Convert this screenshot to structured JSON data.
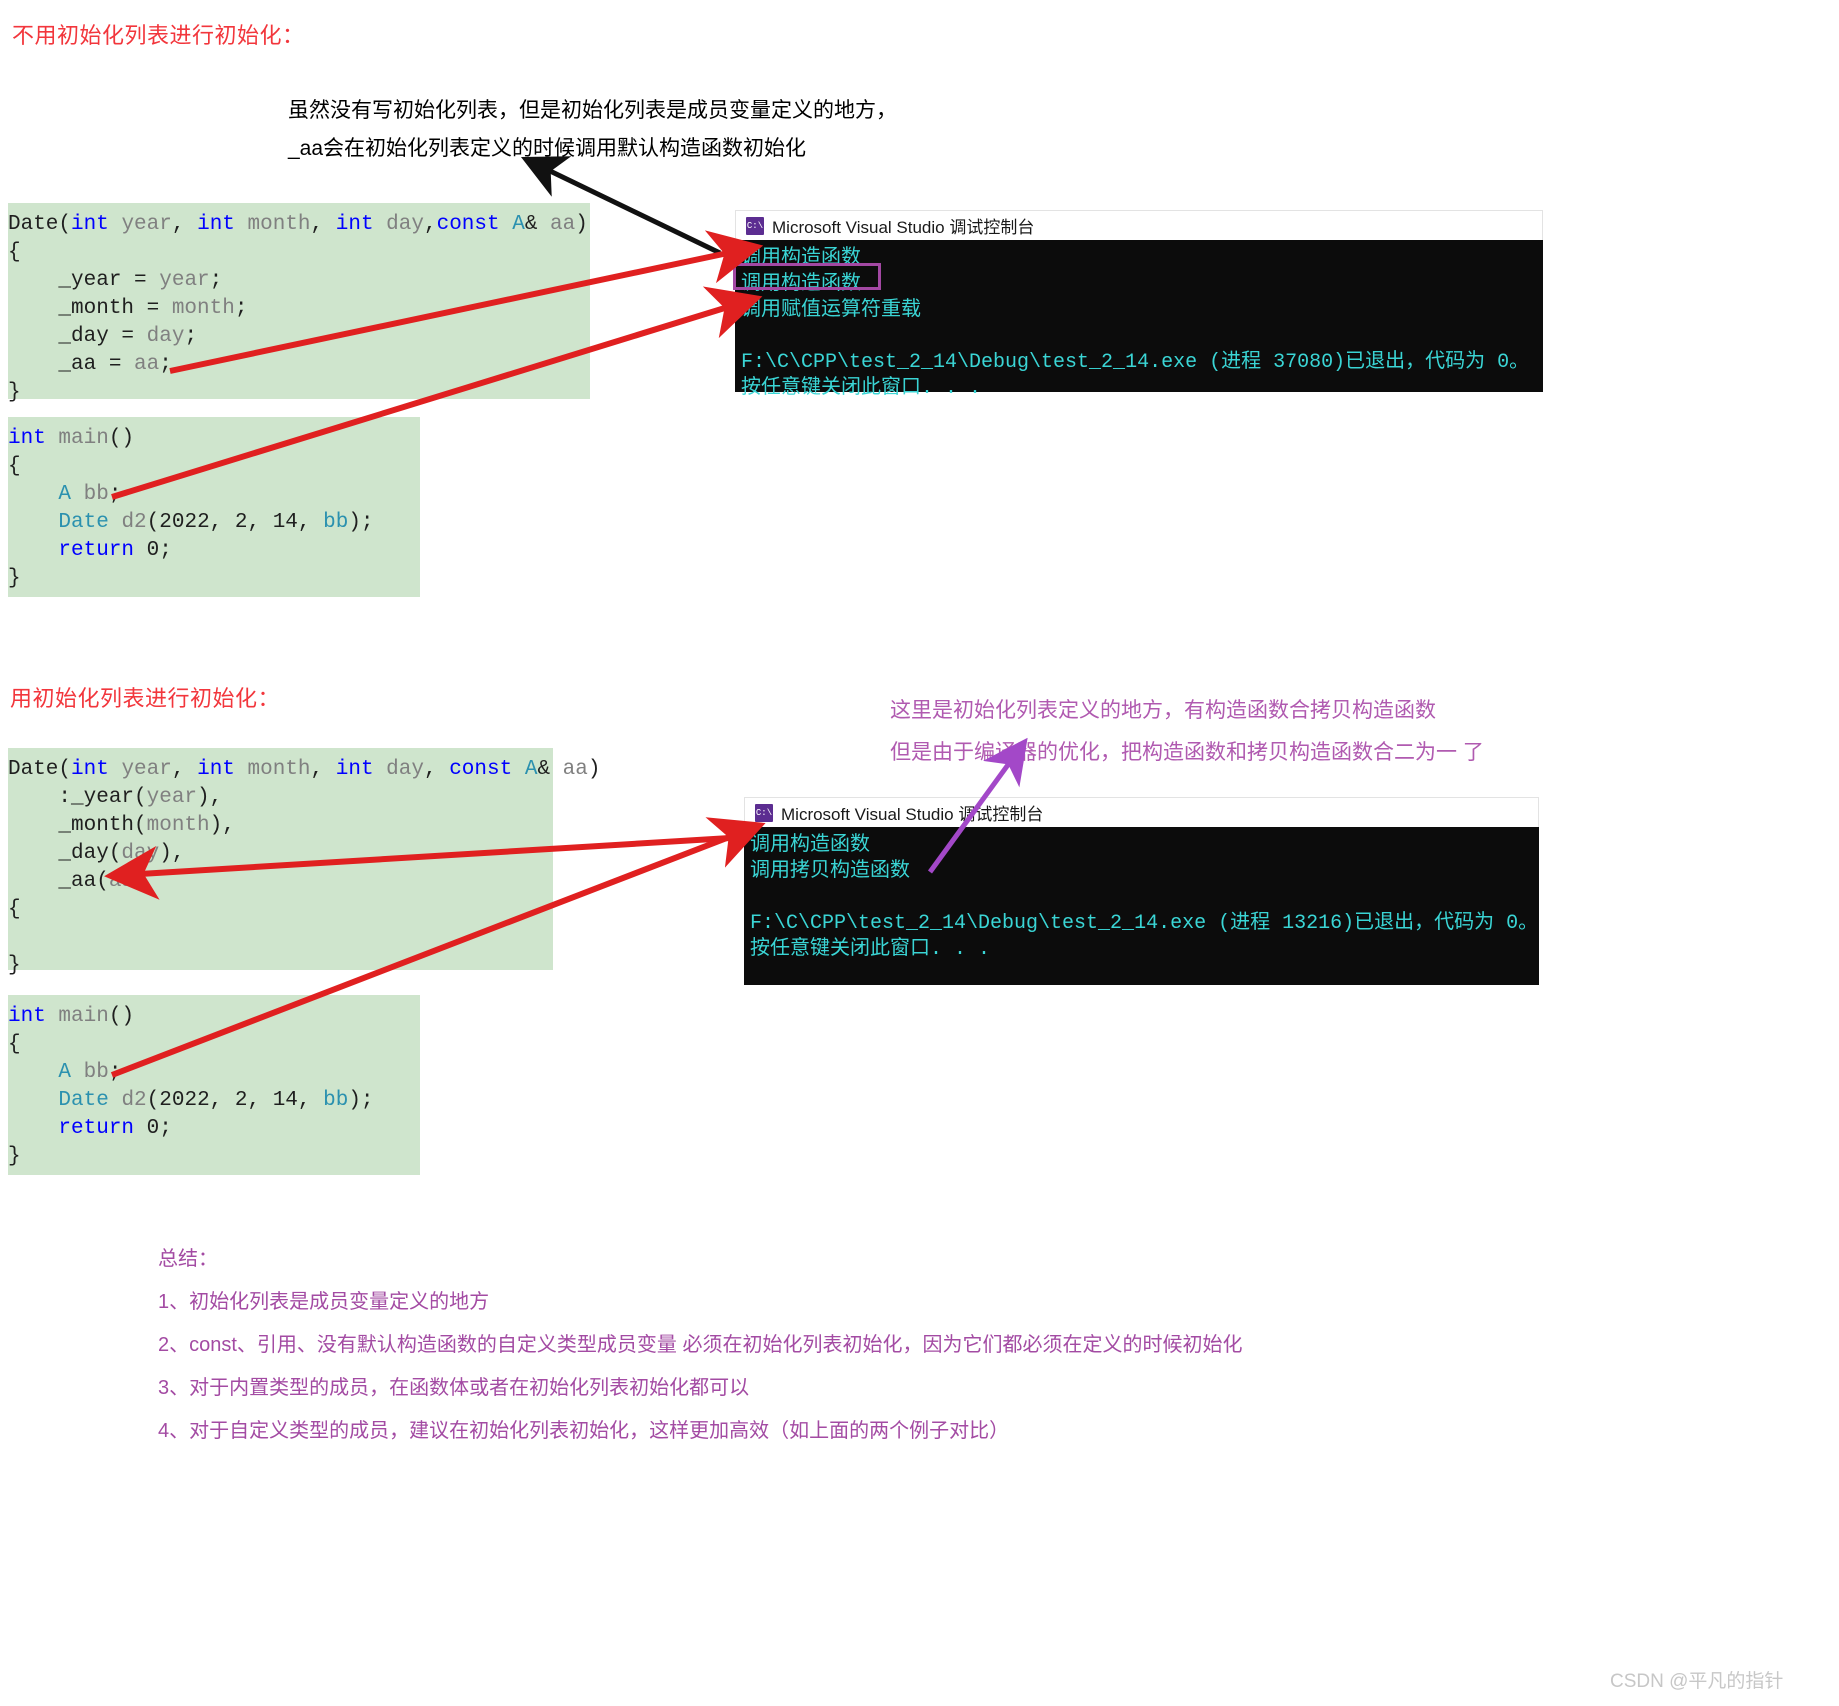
{
  "sections": {
    "first_heading": "不用初始化列表进行初始化：",
    "second_heading": "用初始化列表进行初始化："
  },
  "annotations": {
    "black_line1": "虽然没有写初始化列表，但是初始化列表是成员变量定义的地方，",
    "black_line2": "_aa会在初始化列表定义的时候调用默认构造函数初始化",
    "purple_line1": "这里是初始化列表定义的地方，有构造函数合拷贝构造函数",
    "purple_line2": "但是由于编译器的优化，把构造函数和拷贝构造函数合二为一 了"
  },
  "code_blocks": {
    "ctor_no_init_list": [
      [
        {
          "t": "Date",
          "c": "plain"
        },
        {
          "t": "(",
          "c": "plain"
        },
        {
          "t": "int",
          "c": "kw"
        },
        {
          "t": " ",
          "c": "plain"
        },
        {
          "t": "year",
          "c": "ident"
        },
        {
          "t": ", ",
          "c": "plain"
        },
        {
          "t": "int",
          "c": "kw"
        },
        {
          "t": " ",
          "c": "plain"
        },
        {
          "t": "month",
          "c": "ident"
        },
        {
          "t": ", ",
          "c": "plain"
        },
        {
          "t": "int",
          "c": "kw"
        },
        {
          "t": " ",
          "c": "plain"
        },
        {
          "t": "day",
          "c": "ident"
        },
        {
          "t": ",",
          "c": "plain"
        },
        {
          "t": "const",
          "c": "kw"
        },
        {
          "t": " ",
          "c": "plain"
        },
        {
          "t": "A",
          "c": "type"
        },
        {
          "t": "& ",
          "c": "plain"
        },
        {
          "t": "aa",
          "c": "ident"
        },
        {
          "t": ")",
          "c": "plain"
        }
      ],
      [
        {
          "t": "{",
          "c": "plain"
        }
      ],
      [
        {
          "t": "    _year = ",
          "c": "plain"
        },
        {
          "t": "year",
          "c": "ident"
        },
        {
          "t": ";",
          "c": "plain"
        }
      ],
      [
        {
          "t": "    _month = ",
          "c": "plain"
        },
        {
          "t": "month",
          "c": "ident"
        },
        {
          "t": ";",
          "c": "plain"
        }
      ],
      [
        {
          "t": "    _day = ",
          "c": "plain"
        },
        {
          "t": "day",
          "c": "ident"
        },
        {
          "t": ";",
          "c": "plain"
        }
      ],
      [
        {
          "t": "    _aa = ",
          "c": "plain"
        },
        {
          "t": "aa",
          "c": "ident"
        },
        {
          "t": ";",
          "c": "plain"
        }
      ],
      [
        {
          "t": "}",
          "c": "plain"
        }
      ]
    ],
    "main_no_init_list": [
      [
        {
          "t": "int",
          "c": "kw"
        },
        {
          "t": " ",
          "c": "plain"
        },
        {
          "t": "main",
          "c": "ident"
        },
        {
          "t": "()",
          "c": "plain"
        }
      ],
      [
        {
          "t": "{",
          "c": "plain"
        }
      ],
      [
        {
          "t": "    ",
          "c": "plain"
        },
        {
          "t": "A",
          "c": "type"
        },
        {
          "t": " ",
          "c": "plain"
        },
        {
          "t": "bb",
          "c": "ident"
        },
        {
          "t": ";",
          "c": "plain"
        }
      ],
      [
        {
          "t": "    ",
          "c": "plain"
        },
        {
          "t": "Date",
          "c": "type"
        },
        {
          "t": " ",
          "c": "plain"
        },
        {
          "t": "d2",
          "c": "ident"
        },
        {
          "t": "(2022, 2, 14, ",
          "c": "plain"
        },
        {
          "t": "bb",
          "c": "type"
        },
        {
          "t": ");",
          "c": "plain"
        }
      ],
      [
        {
          "t": "    ",
          "c": "plain"
        },
        {
          "t": "return",
          "c": "kw"
        },
        {
          "t": " 0;",
          "c": "plain"
        }
      ],
      [
        {
          "t": "}",
          "c": "plain"
        }
      ]
    ],
    "ctor_with_init_list": [
      [
        {
          "t": "Date",
          "c": "plain"
        },
        {
          "t": "(",
          "c": "plain"
        },
        {
          "t": "int",
          "c": "kw"
        },
        {
          "t": " ",
          "c": "plain"
        },
        {
          "t": "year",
          "c": "ident"
        },
        {
          "t": ", ",
          "c": "plain"
        },
        {
          "t": "int",
          "c": "kw"
        },
        {
          "t": " ",
          "c": "plain"
        },
        {
          "t": "month",
          "c": "ident"
        },
        {
          "t": ", ",
          "c": "plain"
        },
        {
          "t": "int",
          "c": "kw"
        },
        {
          "t": " ",
          "c": "plain"
        },
        {
          "t": "day",
          "c": "ident"
        },
        {
          "t": ", ",
          "c": "plain"
        },
        {
          "t": "const",
          "c": "kw"
        },
        {
          "t": " ",
          "c": "plain"
        },
        {
          "t": "A",
          "c": "type"
        },
        {
          "t": "& ",
          "c": "plain"
        },
        {
          "t": "aa",
          "c": "ident"
        },
        {
          "t": ")",
          "c": "plain"
        }
      ],
      [
        {
          "t": "    :_year(",
          "c": "plain"
        },
        {
          "t": "year",
          "c": "ident"
        },
        {
          "t": "),",
          "c": "plain"
        }
      ],
      [
        {
          "t": "    _month(",
          "c": "plain"
        },
        {
          "t": "month",
          "c": "ident"
        },
        {
          "t": "),",
          "c": "plain"
        }
      ],
      [
        {
          "t": "    _day(",
          "c": "plain"
        },
        {
          "t": "day",
          "c": "ident"
        },
        {
          "t": "),",
          "c": "plain"
        }
      ],
      [
        {
          "t": "    _aa(",
          "c": "plain"
        },
        {
          "t": "aa",
          "c": "ident"
        },
        {
          "t": ")",
          "c": "plain"
        }
      ],
      [
        {
          "t": "{",
          "c": "plain"
        }
      ],
      [
        {
          "t": "",
          "c": "plain"
        }
      ],
      [
        {
          "t": "}",
          "c": "plain"
        }
      ]
    ],
    "main_with_init_list": [
      [
        {
          "t": "int",
          "c": "kw"
        },
        {
          "t": " ",
          "c": "plain"
        },
        {
          "t": "main",
          "c": "ident"
        },
        {
          "t": "()",
          "c": "plain"
        }
      ],
      [
        {
          "t": "{",
          "c": "plain"
        }
      ],
      [
        {
          "t": "    ",
          "c": "plain"
        },
        {
          "t": "A",
          "c": "type"
        },
        {
          "t": " ",
          "c": "plain"
        },
        {
          "t": "bb",
          "c": "ident"
        },
        {
          "t": ";",
          "c": "plain"
        }
      ],
      [
        {
          "t": "    ",
          "c": "plain"
        },
        {
          "t": "Date",
          "c": "type"
        },
        {
          "t": " ",
          "c": "plain"
        },
        {
          "t": "d2",
          "c": "ident"
        },
        {
          "t": "(2022, 2, 14, ",
          "c": "plain"
        },
        {
          "t": "bb",
          "c": "type"
        },
        {
          "t": ");",
          "c": "plain"
        }
      ],
      [
        {
          "t": "    ",
          "c": "plain"
        },
        {
          "t": "return",
          "c": "kw"
        },
        {
          "t": " 0;",
          "c": "plain"
        }
      ],
      [
        {
          "t": "}",
          "c": "plain"
        }
      ]
    ]
  },
  "console_one": {
    "icon_label": "C:\\",
    "title": "Microsoft Visual Studio 调试控制台",
    "lines": [
      "调用构造函数",
      "调用构造函数",
      "调用赋值运算符重载",
      "",
      "F:\\C\\CPP\\test_2_14\\Debug\\test_2_14.exe (进程 37080)已退出，代码为 0。",
      "按任意键关闭此窗口. . ."
    ]
  },
  "console_two": {
    "icon_label": "C:\\",
    "title": "Microsoft Visual Studio 调试控制台",
    "lines": [
      "调用构造函数",
      "调用拷贝构造函数",
      "",
      "F:\\C\\CPP\\test_2_14\\Debug\\test_2_14.exe (进程 13216)已退出，代码为 0。",
      "按任意键关闭此窗口. . ."
    ]
  },
  "summary": {
    "title": "总结：",
    "items": [
      "1、初始化列表是成员变量定义的地方",
      "2、const、引用、没有默认构造函数的自定义类型成员变量 必须在初始化列表初始化，因为它们都必须在定义的时候初始化",
      "3、对于内置类型的成员，在函数体或者在初始化列表初始化都可以",
      "4、对于自定义类型的成员，建议在初始化列表初始化，这样更加高效（如上面的两个例子对比）"
    ]
  },
  "watermark": "CSDN @平凡的指针",
  "colors": {
    "heading_red": "#f2363c",
    "annotation_purple": "#b05ab0",
    "summary_purple": "#a34ba3",
    "code_bg": "#cfe5cd",
    "console_bg": "#0c0c0c",
    "console_text": "#3ad5d5",
    "arrow_red": "#e02020",
    "arrow_black": "#000000",
    "arrow_purple": "#a348c8",
    "highlight_border": "#a348a3"
  }
}
